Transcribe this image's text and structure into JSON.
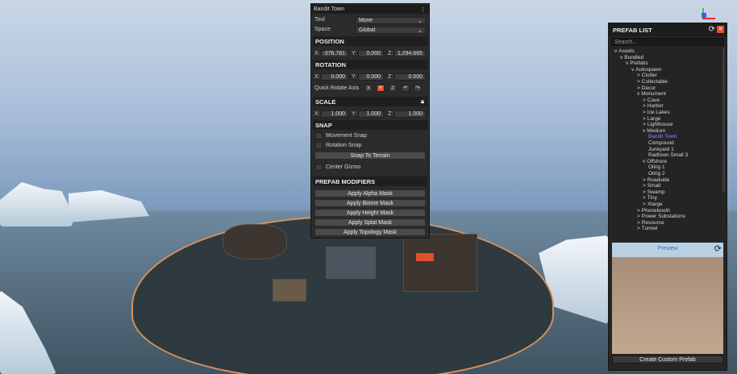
{
  "window_title": "Bandit Town",
  "tool": {
    "label": "Tool",
    "value": "Move"
  },
  "space": {
    "label": "Space",
    "value": "Global"
  },
  "position": {
    "header": "POSITION",
    "x": "-376.781",
    "y": "0.000",
    "z": "1,294.665"
  },
  "rotation": {
    "header": "ROTATION",
    "x": "0.000",
    "y": "0.000",
    "z": "0.000"
  },
  "quick_rotate": {
    "label": "Quick Rotate Axis",
    "x": "X",
    "y": "Y",
    "z": "Z"
  },
  "scale": {
    "header": "SCALE",
    "x": "1.000",
    "y": "1.000",
    "z": "1.000"
  },
  "axis_labels": {
    "x": "X:",
    "y": "Y:",
    "z": "Z:"
  },
  "snap": {
    "header": "SNAP",
    "movement": "Movement Snap",
    "rotation": "Rotation Snap",
    "to_terrain": "Snap To Terrain",
    "center_gizmo": "Center Gizmo"
  },
  "modifiers": {
    "header": "PREFAB MODIFIERS",
    "alpha": "Apply Alpha Mask",
    "biome": "Apply Biome Mask",
    "height": "Apply Height Mask",
    "splat": "Apply Splat Mask",
    "topology": "Apply Topology Mask"
  },
  "prefab_list": {
    "title": "PREFAB LIST",
    "search_placeholder": "Search...",
    "tree": [
      {
        "label": "Assets",
        "arrow": "v",
        "depth": 0
      },
      {
        "label": "Bundled",
        "arrow": "v",
        "depth": 1
      },
      {
        "label": "Prefabs",
        "arrow": "v",
        "depth": 2
      },
      {
        "label": "Autospawn",
        "arrow": "v",
        "depth": 3
      },
      {
        "label": "Clutter",
        "arrow": ">",
        "depth": 4
      },
      {
        "label": "Collectable",
        "arrow": ">",
        "depth": 4
      },
      {
        "label": "Decor",
        "arrow": ">",
        "depth": 4
      },
      {
        "label": "Monument",
        "arrow": "v",
        "depth": 4
      },
      {
        "label": "Cave",
        "arrow": ">",
        "depth": 5
      },
      {
        "label": "Harbor",
        "arrow": ">",
        "depth": 5
      },
      {
        "label": "Ice Lakes",
        "arrow": ">",
        "depth": 5
      },
      {
        "label": "Large",
        "arrow": ">",
        "depth": 5
      },
      {
        "label": "Lighthouse",
        "arrow": ">",
        "depth": 5
      },
      {
        "label": "Medium",
        "arrow": "v",
        "depth": 5
      },
      {
        "label": "Bandit Town",
        "arrow": "",
        "depth": 6,
        "selected": true
      },
      {
        "label": "Compound",
        "arrow": "",
        "depth": 6
      },
      {
        "label": "Junkyard 1",
        "arrow": "",
        "depth": 6
      },
      {
        "label": "Radtown Small 3",
        "arrow": "",
        "depth": 6
      },
      {
        "label": "Offshore",
        "arrow": "v",
        "depth": 5
      },
      {
        "label": "Oilrig 1",
        "arrow": "",
        "depth": 6
      },
      {
        "label": "Oilrig 2",
        "arrow": "",
        "depth": 6
      },
      {
        "label": "Roadside",
        "arrow": ">",
        "depth": 5
      },
      {
        "label": "Small",
        "arrow": ">",
        "depth": 5
      },
      {
        "label": "Swamp",
        "arrow": ">",
        "depth": 5
      },
      {
        "label": "Tiny",
        "arrow": ">",
        "depth": 5
      },
      {
        "label": "Xlarge",
        "arrow": ">",
        "depth": 5
      },
      {
        "label": "Phonebooth",
        "arrow": ">",
        "depth": 4
      },
      {
        "label": "Power Substations",
        "arrow": ">",
        "depth": 4
      },
      {
        "label": "Resource",
        "arrow": ">",
        "depth": 4
      },
      {
        "label": "Tunnel",
        "arrow": ">",
        "depth": 4
      }
    ],
    "preview_label": "Preview",
    "create_button": "Create Custom Prefab"
  },
  "colors": {
    "accent": "#e0502a",
    "selected_text": "#7f8dff",
    "panel": "#2b2b2b"
  }
}
